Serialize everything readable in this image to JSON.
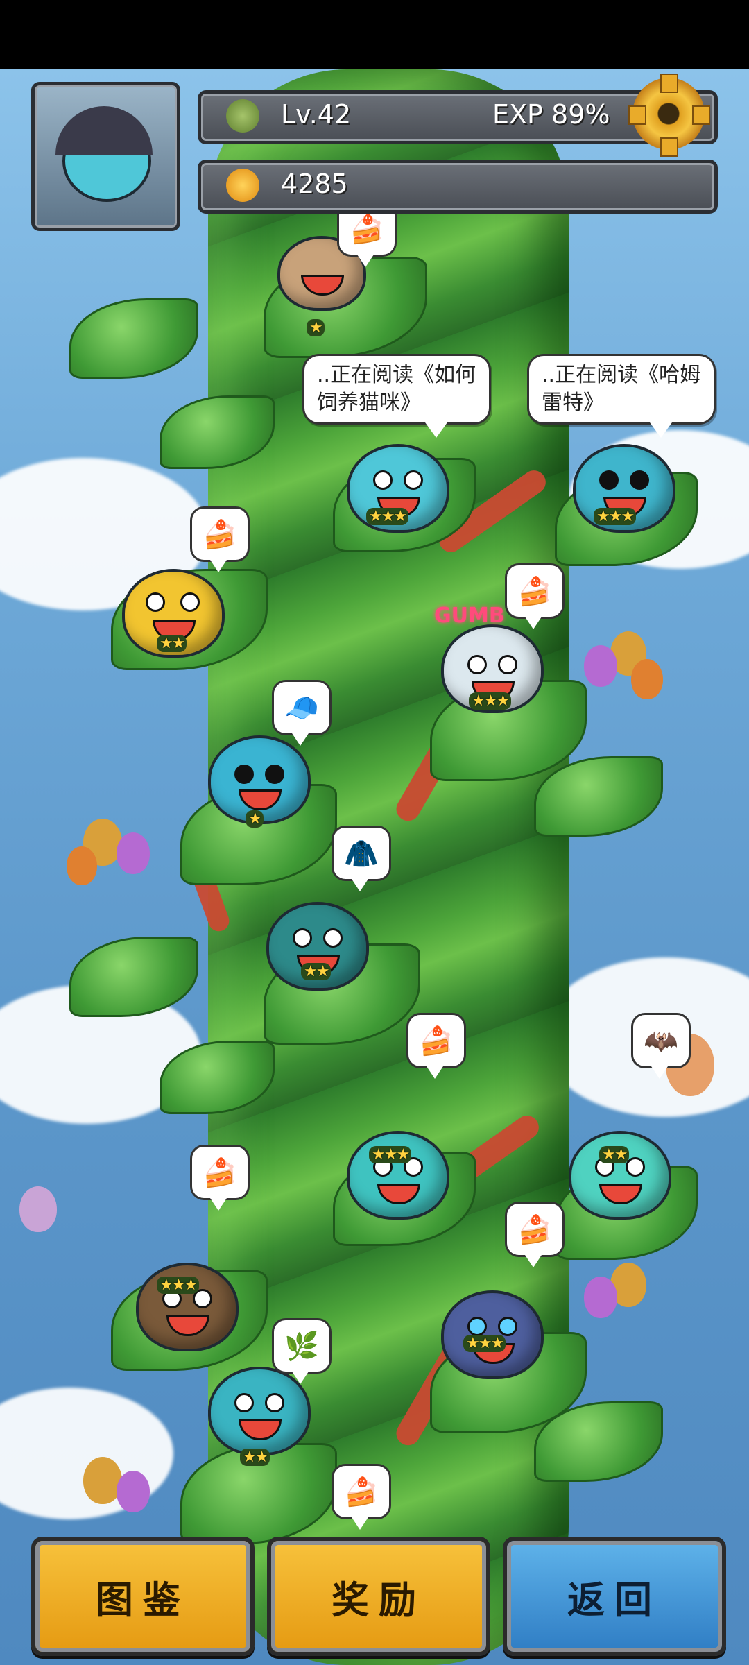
{
  "player": {
    "level": "Lv.42",
    "exp": "EXP 89%",
    "currency": "4285"
  },
  "bubbles": {
    "left": "..正在阅读《如何饲养猫咪》",
    "right": "..正在阅读《哈姆雷特》"
  },
  "decor": {
    "sign_text": "GUMB"
  },
  "buttons": {
    "atlas": "图鉴",
    "reward": "奖励",
    "back": "返回"
  },
  "characters": [
    {
      "stars": "★"
    },
    {
      "stars": "★★★"
    },
    {
      "stars": "★★★"
    },
    {
      "stars": "★★"
    },
    {
      "stars": "★★★"
    },
    {
      "stars": "★"
    },
    {
      "stars": "★★"
    },
    {
      "stars": "★★★"
    },
    {
      "stars": "★★"
    },
    {
      "stars": "★★★"
    },
    {
      "stars": "★★★"
    },
    {
      "stars": "★★"
    }
  ],
  "colors": {
    "gold_button": "#f0ae24",
    "blue_button": "#3f8fd6",
    "sky": "#6ea9d8",
    "beanstalk": "#4da53a"
  }
}
